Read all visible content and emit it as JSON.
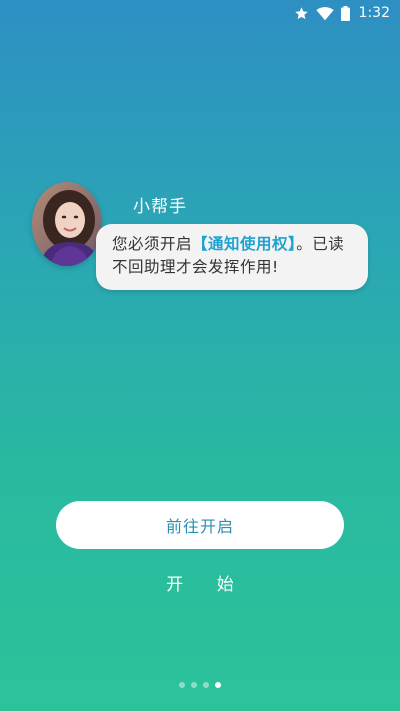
{
  "status_bar": {
    "time": "1:32",
    "icons": [
      "star-icon",
      "wifi-icon",
      "battery-icon"
    ]
  },
  "assistant": {
    "name": "小帮手",
    "avatar": "avatar-photo"
  },
  "message": {
    "prefix": "您必须开启",
    "highlight": "【通知使用权】",
    "suffix": "。已读不回助理才会发挥作用!"
  },
  "actions": {
    "go_enable_label": "前往开启",
    "start_label": "开 始"
  },
  "pager": {
    "total": 4,
    "current": 4
  },
  "colors": {
    "gradient_top": "#2e8fc3",
    "gradient_bottom": "#2cc39a",
    "highlight": "#1ea3d0",
    "button_text": "#2a8fb0"
  }
}
